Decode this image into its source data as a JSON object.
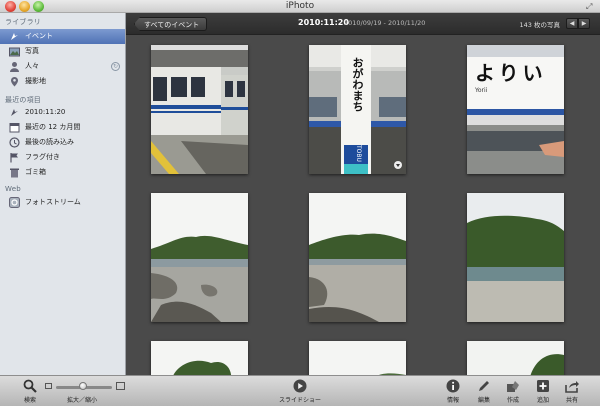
{
  "window": {
    "title": "iPhoto"
  },
  "sidebar": {
    "library_header": "ライブラリ",
    "library_items": [
      {
        "label": "イベント",
        "icon": "events-icon",
        "selected": true
      },
      {
        "label": "写真",
        "icon": "photos-icon"
      },
      {
        "label": "人々",
        "icon": "faces-icon"
      },
      {
        "label": "撮影地",
        "icon": "places-icon"
      }
    ],
    "recent_header": "最近の項目",
    "recent_items": [
      {
        "label": "2010:11:20",
        "icon": "event-icon"
      },
      {
        "label": "最近の 12 カ月間",
        "icon": "calendar-icon"
      },
      {
        "label": "最後の読み込み",
        "icon": "last-import-icon"
      },
      {
        "label": "フラグ付き",
        "icon": "flag-icon"
      },
      {
        "label": "ゴミ箱",
        "icon": "trash-icon"
      }
    ],
    "web_header": "Web",
    "web_items": [
      {
        "label": "フォトストリーム",
        "icon": "photostream-icon"
      }
    ]
  },
  "toolbar": {
    "back_label": "すべてのイベント",
    "event_title": "2010:11:20",
    "date_range": "2010/09/19 - 2010/11/20",
    "photo_count": "143 枚の写真"
  },
  "bottom_toolbar": {
    "search": "検索",
    "zoom": "拡大／縮小",
    "slideshow": "スライドショー",
    "info": "情報",
    "edit": "編集",
    "create": "作成",
    "add": "追加",
    "share": "共有"
  },
  "photos": {
    "station_sign_text": "おがわまち",
    "station_sign_sub": "TOBU",
    "station_sign2_text": "よりい",
    "station_sign2_sub": "Yorii"
  },
  "colors": {
    "selection": "#5b7cbd",
    "main_bg": "#4a4a4a",
    "sidebar_bg": "#e1e5ea"
  }
}
